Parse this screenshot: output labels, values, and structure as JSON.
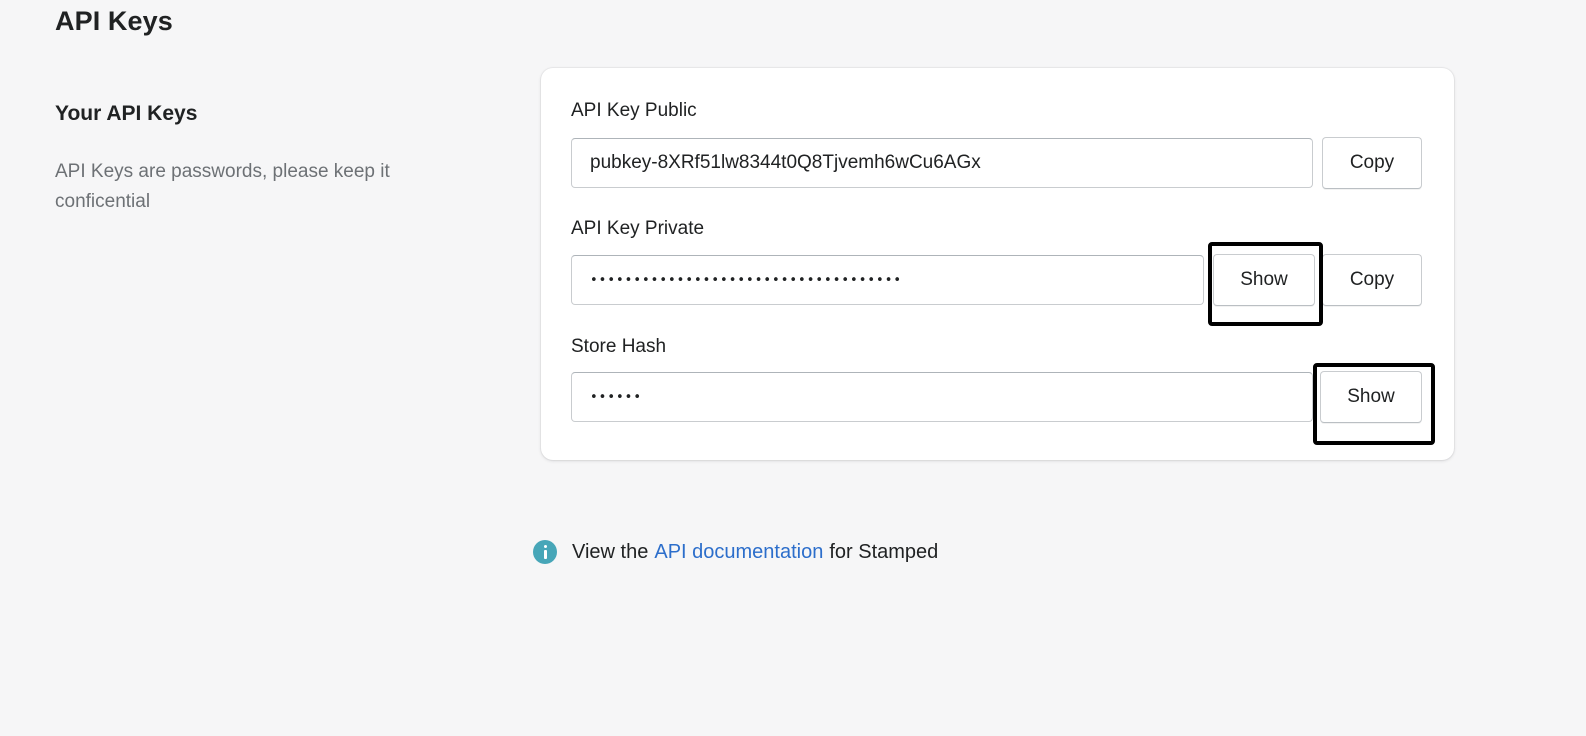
{
  "page": {
    "title": "API Keys"
  },
  "section": {
    "title": "Your API Keys",
    "description": "API Keys are passwords, please keep it conficential"
  },
  "fields": {
    "public": {
      "label": "API Key Public",
      "value": "pubkey-8XRf51lw8344t0Q8Tjvemh6wCu6AGx",
      "copy_label": "Copy"
    },
    "private": {
      "label": "API Key Private",
      "masked_value": "••••••••••••••••••••••••••••••••••••",
      "show_label": "Show",
      "copy_label": "Copy"
    },
    "store_hash": {
      "label": "Store Hash",
      "masked_value": "••••••",
      "show_label": "Show"
    }
  },
  "info": {
    "icon": "info-icon",
    "prefix": "View the",
    "link_text": "API documentation",
    "suffix": "for Stamped"
  },
  "colors": {
    "background": "#f6f6f7",
    "card": "#ffffff",
    "link": "#2c6ecb",
    "info_icon": "#47a6b8",
    "highlight": "#000000"
  }
}
